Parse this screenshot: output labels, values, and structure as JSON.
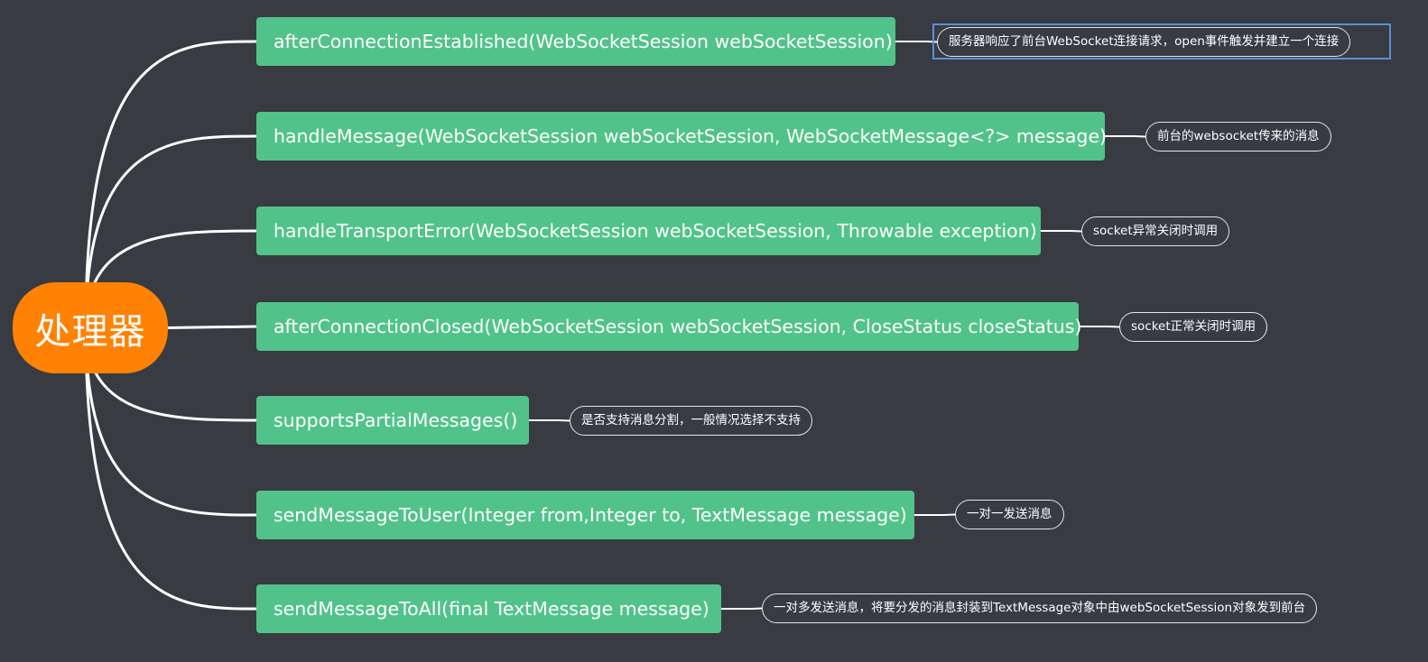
{
  "root": {
    "label": "处理器"
  },
  "colors": {
    "background": "#383b41",
    "root": "#ff8205",
    "topic": "#51c38a",
    "connector": "#ffffff",
    "selection": "#5b8fd8"
  },
  "topics": [
    {
      "label": "afterConnectionEstablished(WebSocketSession webSocketSession)",
      "note": "服务器响应了前台WebSocket连接请求，open事件触发并建立一个连接",
      "selected": true
    },
    {
      "label": "handleMessage(WebSocketSession webSocketSession, WebSocketMessage<?> message)",
      "note": "前台的websocket传来的消息"
    },
    {
      "label": "handleTransportError(WebSocketSession webSocketSession, Throwable exception)",
      "note": "socket异常关闭时调用"
    },
    {
      "label": "afterConnectionClosed(WebSocketSession webSocketSession, CloseStatus closeStatus)",
      "note": "socket正常关闭时调用"
    },
    {
      "label": "supportsPartialMessages()",
      "note": "是否支持消息分割，一般情况选择不支持"
    },
    {
      "label": "sendMessageToUser(Integer from,Integer to, TextMessage message)",
      "note": "一对一发送消息"
    },
    {
      "label": "sendMessageToAll(final TextMessage message)",
      "note": "一对多发送消息，将要分发的消息封装到TextMessage对象中由webSocketSession对象发到前台"
    }
  ]
}
